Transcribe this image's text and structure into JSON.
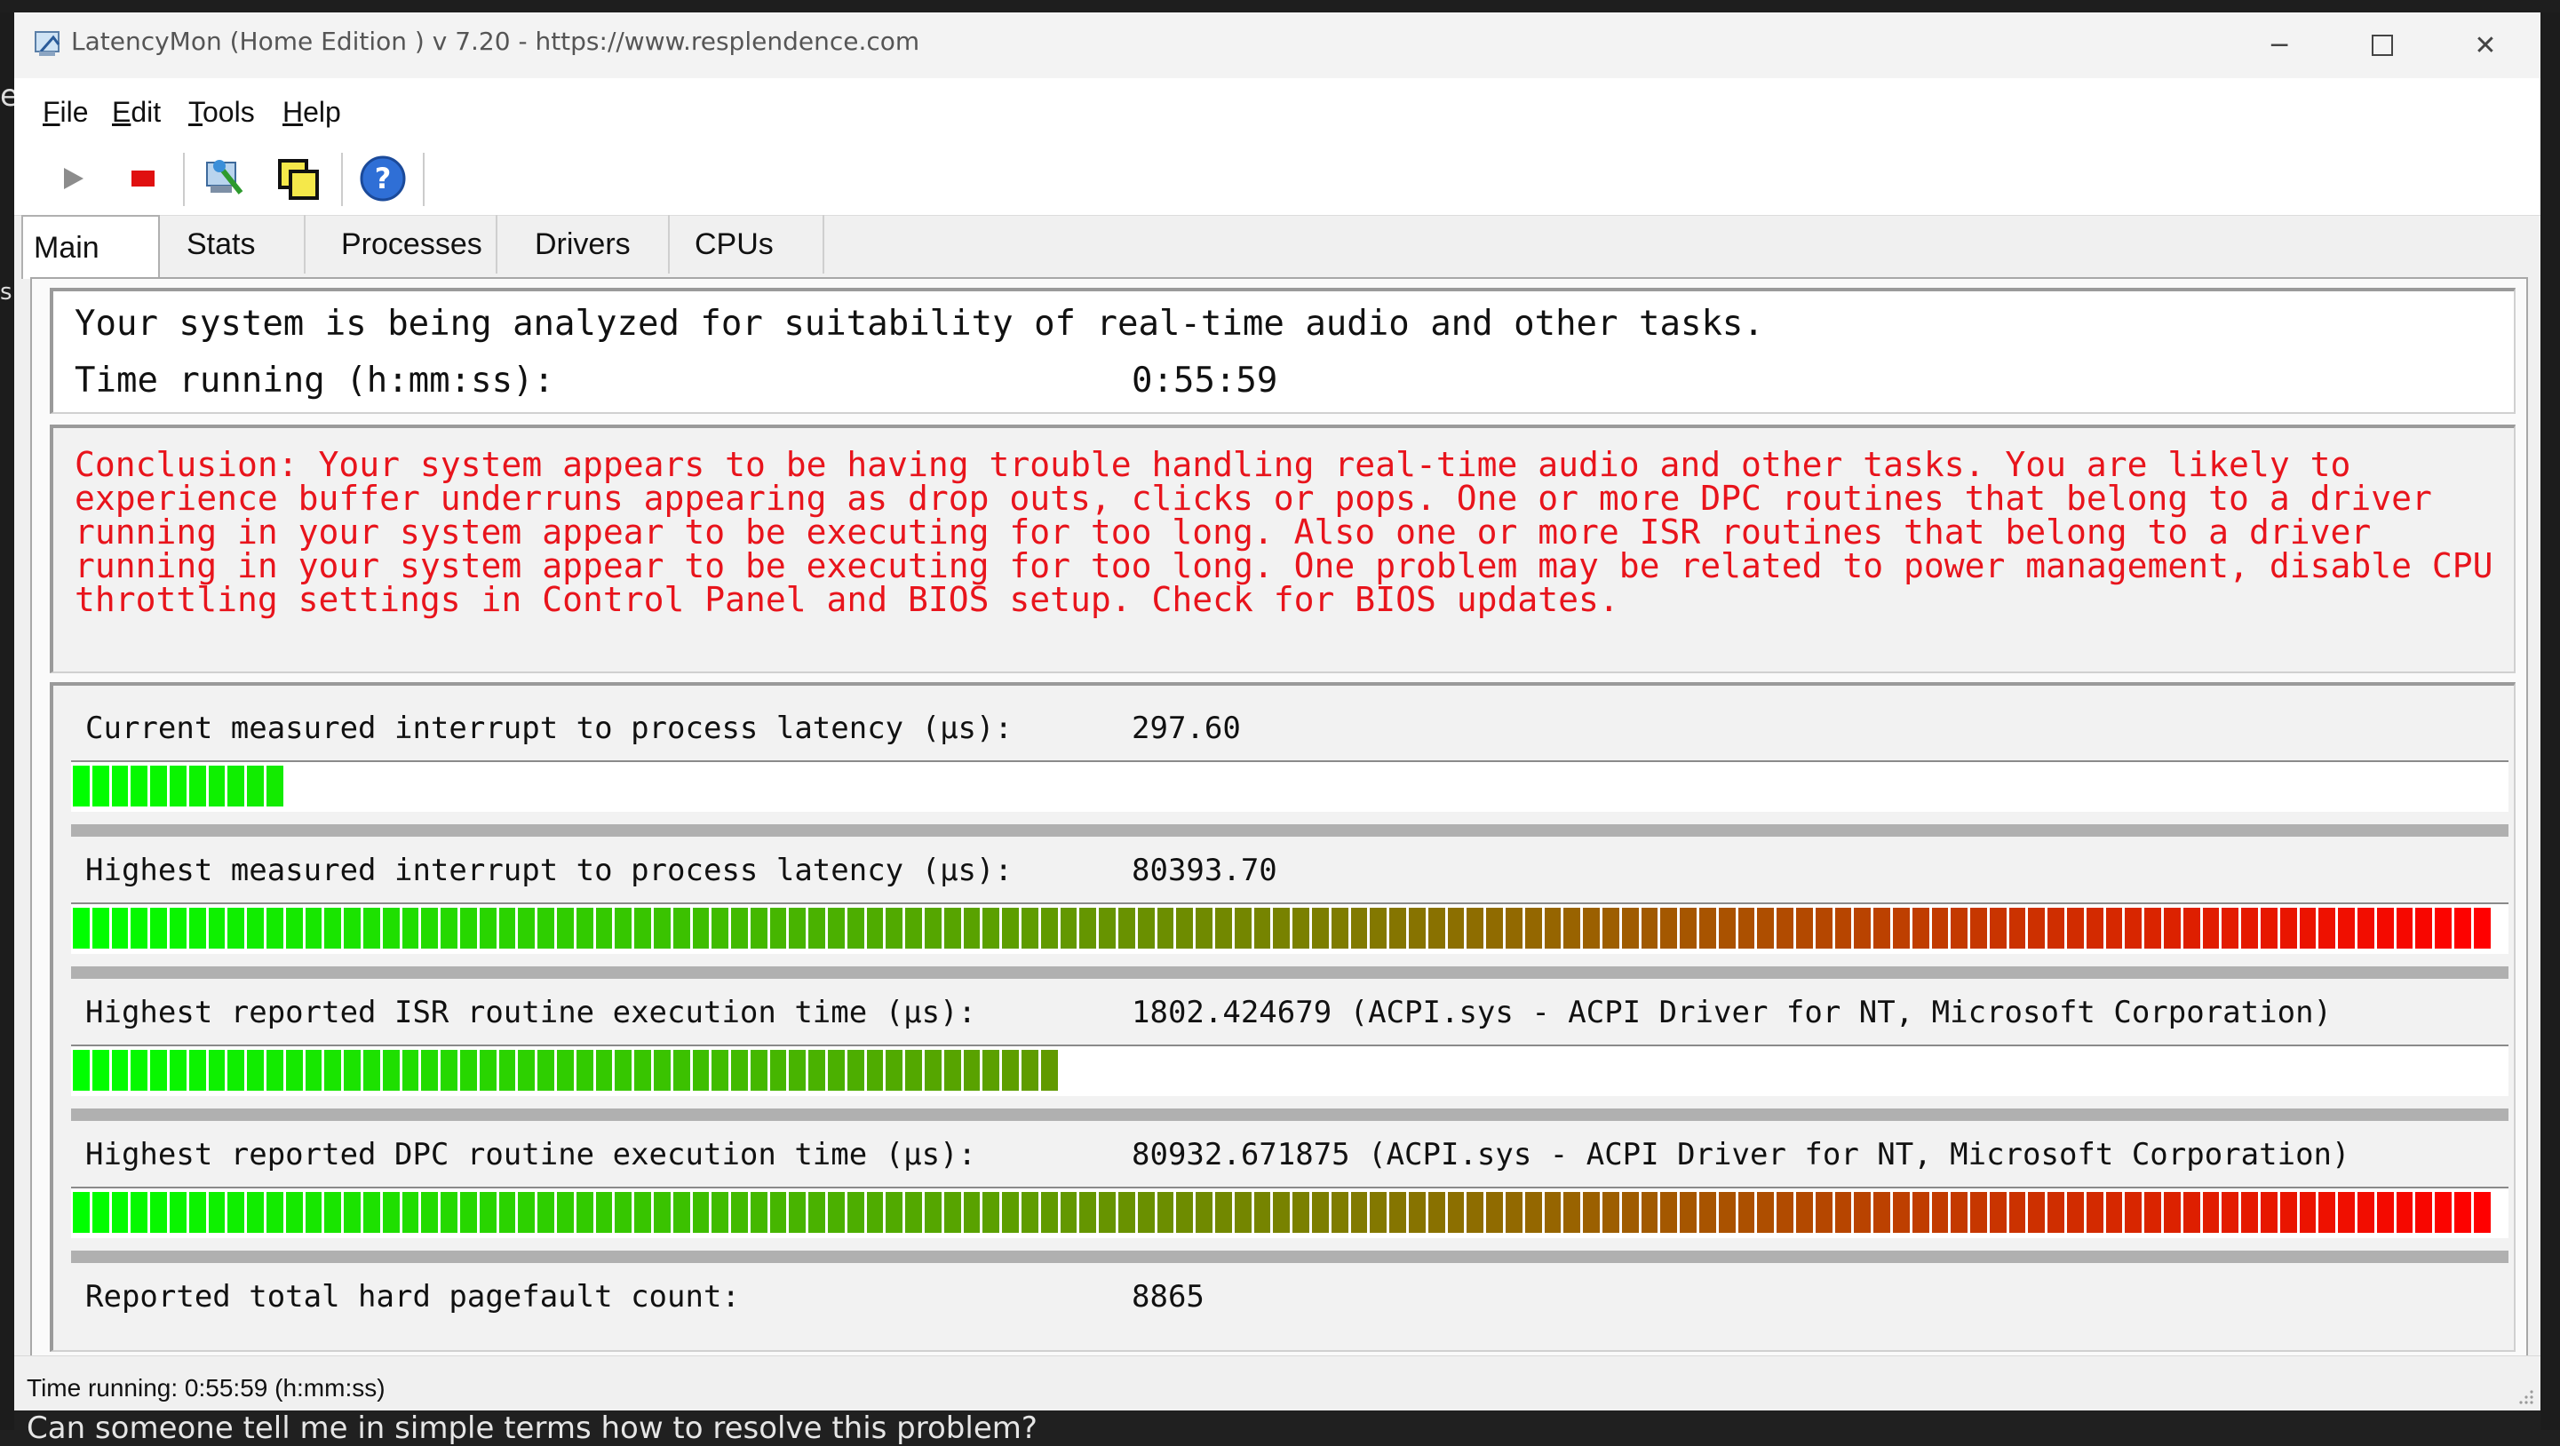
{
  "window": {
    "title": "LatencyMon  (Home Edition )  v 7.20 - https://www.resplendence.com"
  },
  "background": {
    "left_glyphs": [
      "e",
      "s"
    ],
    "bottom_text": "Can someone tell me in simple terms how to resolve this problem?"
  },
  "menu": {
    "file": "File",
    "edit": "Edit",
    "tools": "Tools",
    "help": "Help"
  },
  "toolbar": {
    "icons": [
      "play-icon",
      "stop-icon",
      "system-info-icon",
      "windows-icon",
      "help-icon"
    ]
  },
  "tabs": {
    "main": "Main",
    "stats": "Stats",
    "processes": "Processes",
    "drivers": "Drivers",
    "cpus": "CPUs"
  },
  "main": {
    "analysis_text": "Your system is being analyzed for suitability of real-time audio and other tasks.",
    "time_running_label": "Time running (h:mm:ss):",
    "time_running_value": "0:55:59",
    "conclusion": "Conclusion: Your system appears to be having trouble handling real-time audio and other tasks. You are likely to experience buffer underruns appearing as drop outs, clicks or pops. One or more DPC routines that belong to a driver running in your system appear to be executing for too long. Also one or more ISR routines that belong to a driver running in your system appear to be executing for too long. One problem may be related to power management, disable CPU throttling settings in Control Panel and BIOS setup. Check for BIOS updates.",
    "conclusion_color": "#e8141c",
    "metrics": [
      {
        "label": "Current measured interrupt to process latency (µs):",
        "value": "297.60",
        "bar_fraction": 0.086
      },
      {
        "label": "Highest measured interrupt to process latency (µs):",
        "value": "80393.70",
        "bar_fraction": 1.0
      },
      {
        "label": "Highest reported ISR routine execution time (µs):",
        "value": "1802.424679  (ACPI.sys - ACPI Driver for NT, Microsoft Corporation)",
        "bar_fraction": 0.407
      },
      {
        "label": "Highest reported DPC routine execution time (µs):",
        "value": "80932.671875  (ACPI.sys - ACPI Driver for NT, Microsoft Corporation)",
        "bar_fraction": 1.0
      }
    ],
    "pagefault_label": "Reported total hard pagefault count:",
    "pagefault_value": "8865",
    "bar_colors": {
      "start": "#00ff00",
      "end": "#ff0000"
    }
  },
  "status": {
    "text": "Time running: 0:55:59  (h:mm:ss)"
  }
}
